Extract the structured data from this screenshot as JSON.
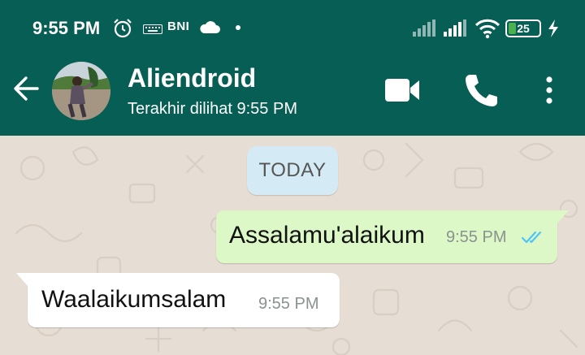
{
  "status_bar": {
    "time": "9:55 PM",
    "carrier_badge": "BNI",
    "battery_level": "25",
    "battery_fraction": 0.25,
    "icons": [
      "alarm-icon",
      "keyboard-icon",
      "cloud-icon",
      "dot",
      "signal-icon",
      "signal-icon",
      "wifi-icon",
      "battery-icon",
      "charging-icon"
    ]
  },
  "header": {
    "contact_name": "Aliendroid",
    "last_seen": "Terakhir dilihat 9:55 PM",
    "icons": [
      "back-arrow-icon",
      "video-call-icon",
      "voice-call-icon",
      "more-options-icon"
    ]
  },
  "chat": {
    "date_divider": "TODAY",
    "messages": [
      {
        "direction": "outgoing",
        "text": "Assalamu'alaikum",
        "time": "9:55 PM",
        "status": "read"
      },
      {
        "direction": "incoming",
        "text": "Waalaikumsalam",
        "time": "9:55 PM"
      }
    ]
  },
  "colors": {
    "header": "#075e54",
    "chat_background": "#e6ddd4",
    "outgoing_bubble": "#dcf8c6",
    "incoming_bubble": "#ffffff",
    "date_chip": "#d4eaf4",
    "read_ticks": "#4fc3f7",
    "battery_fill": "#4caf50"
  }
}
